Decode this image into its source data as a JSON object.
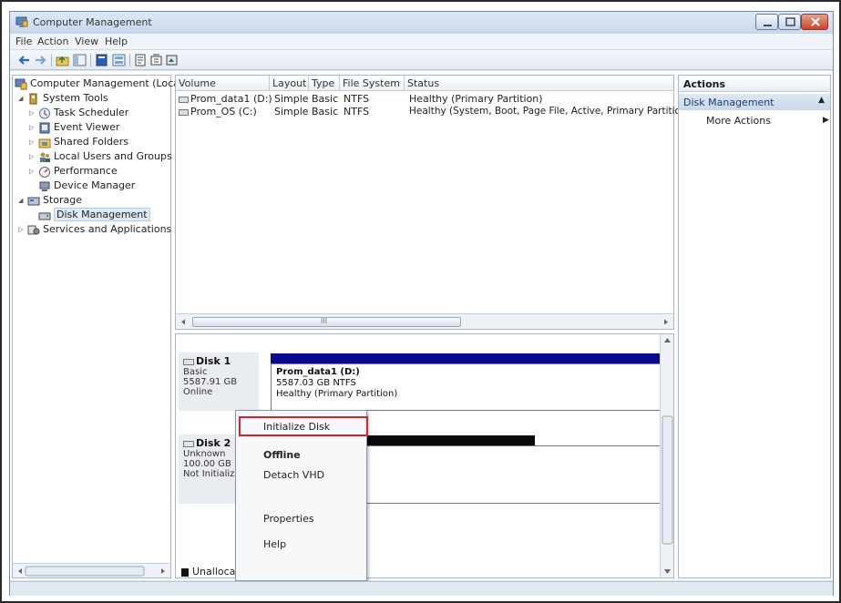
{
  "window": {
    "title": "Computer Management"
  },
  "menu": [
    "File",
    "Action",
    "View",
    "Help"
  ],
  "toolbar": {
    "icons": [
      "back-arrow-icon",
      "forward-arrow-icon",
      "up-folder-icon",
      "show-hide-tree-icon",
      "properties-icon",
      "help-icon",
      "export-list-icon",
      "settings-icon",
      "refresh-icon"
    ]
  },
  "tree": {
    "root": "Computer Management (Local",
    "system_tools": "System Tools",
    "task_scheduler": "Task Scheduler",
    "event_viewer": "Event Viewer",
    "shared_folders": "Shared Folders",
    "local_users": "Local Users and Groups",
    "performance": "Performance",
    "device_manager": "Device Manager",
    "storage": "Storage",
    "disk_management": "Disk Management",
    "services": "Services and Applications"
  },
  "volume_list": {
    "columns": [
      "Volume",
      "Layout",
      "Type",
      "File System",
      "Status"
    ],
    "rows": [
      {
        "volume": "Prom_data1 (D:)",
        "layout": "Simple",
        "type": "Basic",
        "fs": "NTFS",
        "status": "Healthy (Primary Partition)"
      },
      {
        "volume": "Prom_OS (C:)",
        "layout": "Simple",
        "type": "Basic",
        "fs": "NTFS",
        "status": "Healthy (System, Boot, Page File, Active, Primary Partition)"
      }
    ],
    "scroll_marker": "III"
  },
  "disks": [
    {
      "name": "Disk 1",
      "type": "Basic",
      "size": "5587.91 GB",
      "state": "Online",
      "bar_color": "#0a0a8c",
      "partition": {
        "name": "Prom_data1  (D:)",
        "size_fs": "5587.03 GB NTFS",
        "status": "Healthy (Primary Partition)"
      }
    },
    {
      "name": "Disk 2",
      "type": "Unknown",
      "size": "100.00 GB",
      "state": "Not Initializ",
      "bar_color": "#0a0a0a"
    }
  ],
  "legend": {
    "unallocated": "Unallocat"
  },
  "context_menu": {
    "items": [
      "Initialize Disk",
      "Offline",
      "Detach VHD",
      "Properties",
      "Help"
    ],
    "highlight_color": "#d8232a"
  },
  "actions": {
    "title": "Actions",
    "group": "Disk Management",
    "more": "More Actions"
  }
}
